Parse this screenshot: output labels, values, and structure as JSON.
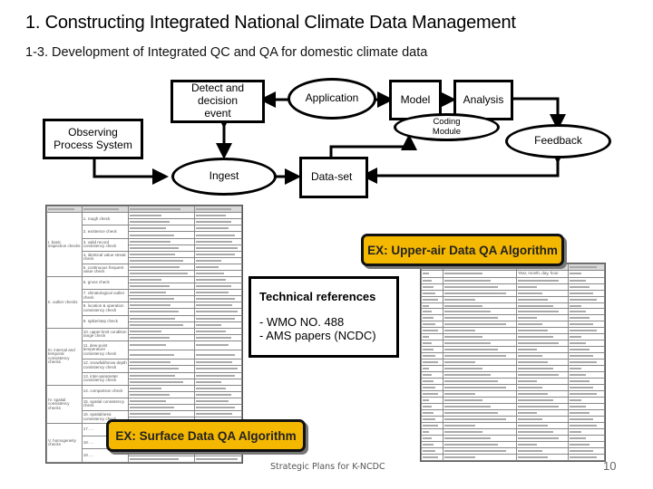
{
  "header": {
    "title": "1. Constructing Integrated National Climate Data Management",
    "subtitle": "1-3. Development of Integrated QC and QA for domestic climate data"
  },
  "diagram": {
    "nodes": {
      "detect": "Detect  and decision event",
      "application": "Application",
      "model": "Model",
      "analysis": "Analysis",
      "coding_module": "Coding Module",
      "observing": "Observing Process System",
      "feedback": "Feedback",
      "ingest": "Ingest",
      "dataset": "Data-set"
    }
  },
  "callouts": {
    "upper_air": "EX: Upper-air Data QA Algorithm",
    "surface": "EX: Surface Data QA Algorithm",
    "accent_color": "#f5b800"
  },
  "references": {
    "heading": "Technical references",
    "items": [
      "- WMO NO. 488",
      "- AMS papers (NCDC)"
    ]
  },
  "surface_table": {
    "groups": [
      {
        "label": "I. basic inspection checks",
        "items": [
          "1. rough check",
          "2. existence check",
          "3. valid record consistency check",
          "4. identical value streak check",
          "5. continuous frequent value check"
        ]
      },
      {
        "label": "II. outlier checks",
        "items": [
          "6. gross check",
          "7. climatological outlier check",
          "8. location & operation consistency check",
          "9. spike/step check"
        ]
      },
      {
        "label": "III. internal and temporal consistency checks",
        "items": [
          "10. upper-limit condition range check",
          "11. dew-point temperature consistency check",
          "12. snowfall/snow depth consistency check",
          "13. inter-parameter consistency check"
        ]
      },
      {
        "label": "IV. spatial consistency checks",
        "items": [
          "14. comparison check",
          "15. spatial consistency check",
          "16. spatial/area consistency check"
        ]
      },
      {
        "label": "V. homogeneity checks",
        "items": [
          "17. ...",
          "18. ...",
          "19. ..."
        ]
      }
    ]
  },
  "upper_air_table": {
    "rows": 30,
    "legible_fragments": [
      "Year, month, day, hour"
    ]
  },
  "footer": {
    "text": "Strategic Plans for K-NCDC",
    "page": "10"
  }
}
